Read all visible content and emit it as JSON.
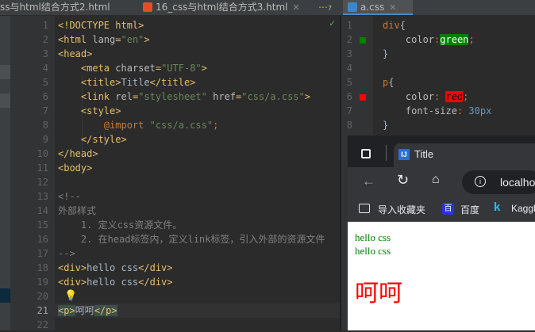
{
  "tabs": [
    {
      "label": "ss与html结合方式2.html",
      "active": false
    },
    {
      "label": "16_css与html结合方式3.html",
      "active": false
    },
    {
      "label": "a.css",
      "active": true
    }
  ],
  "tab_overflow_count": "7",
  "left_editor": {
    "line_numbers": [
      "1",
      "2",
      "3",
      "4",
      "5",
      "6",
      "7",
      "8",
      "9",
      "10",
      "11",
      "12",
      "13",
      "14",
      "15",
      "16",
      "17",
      "18",
      "19",
      "20",
      "21",
      "22"
    ],
    "current_line": "21"
  },
  "right_editor": {
    "line_numbers": [
      "1",
      "2",
      "3",
      "4",
      "5",
      "6",
      "7",
      "8"
    ]
  },
  "browser": {
    "tab_title": "Title",
    "address": "localho",
    "bookmarks": [
      "导入收藏夹",
      "百度",
      "Kaggl"
    ],
    "content": {
      "lines": [
        "hello css",
        "hello css"
      ],
      "big_text": "呵呵",
      "text_color": "#008000",
      "big_color": "#ff0000"
    }
  },
  "colors": {
    "green_swatch": "#008000",
    "red_swatch": "#ff0000",
    "accent": "#4a88c7"
  }
}
